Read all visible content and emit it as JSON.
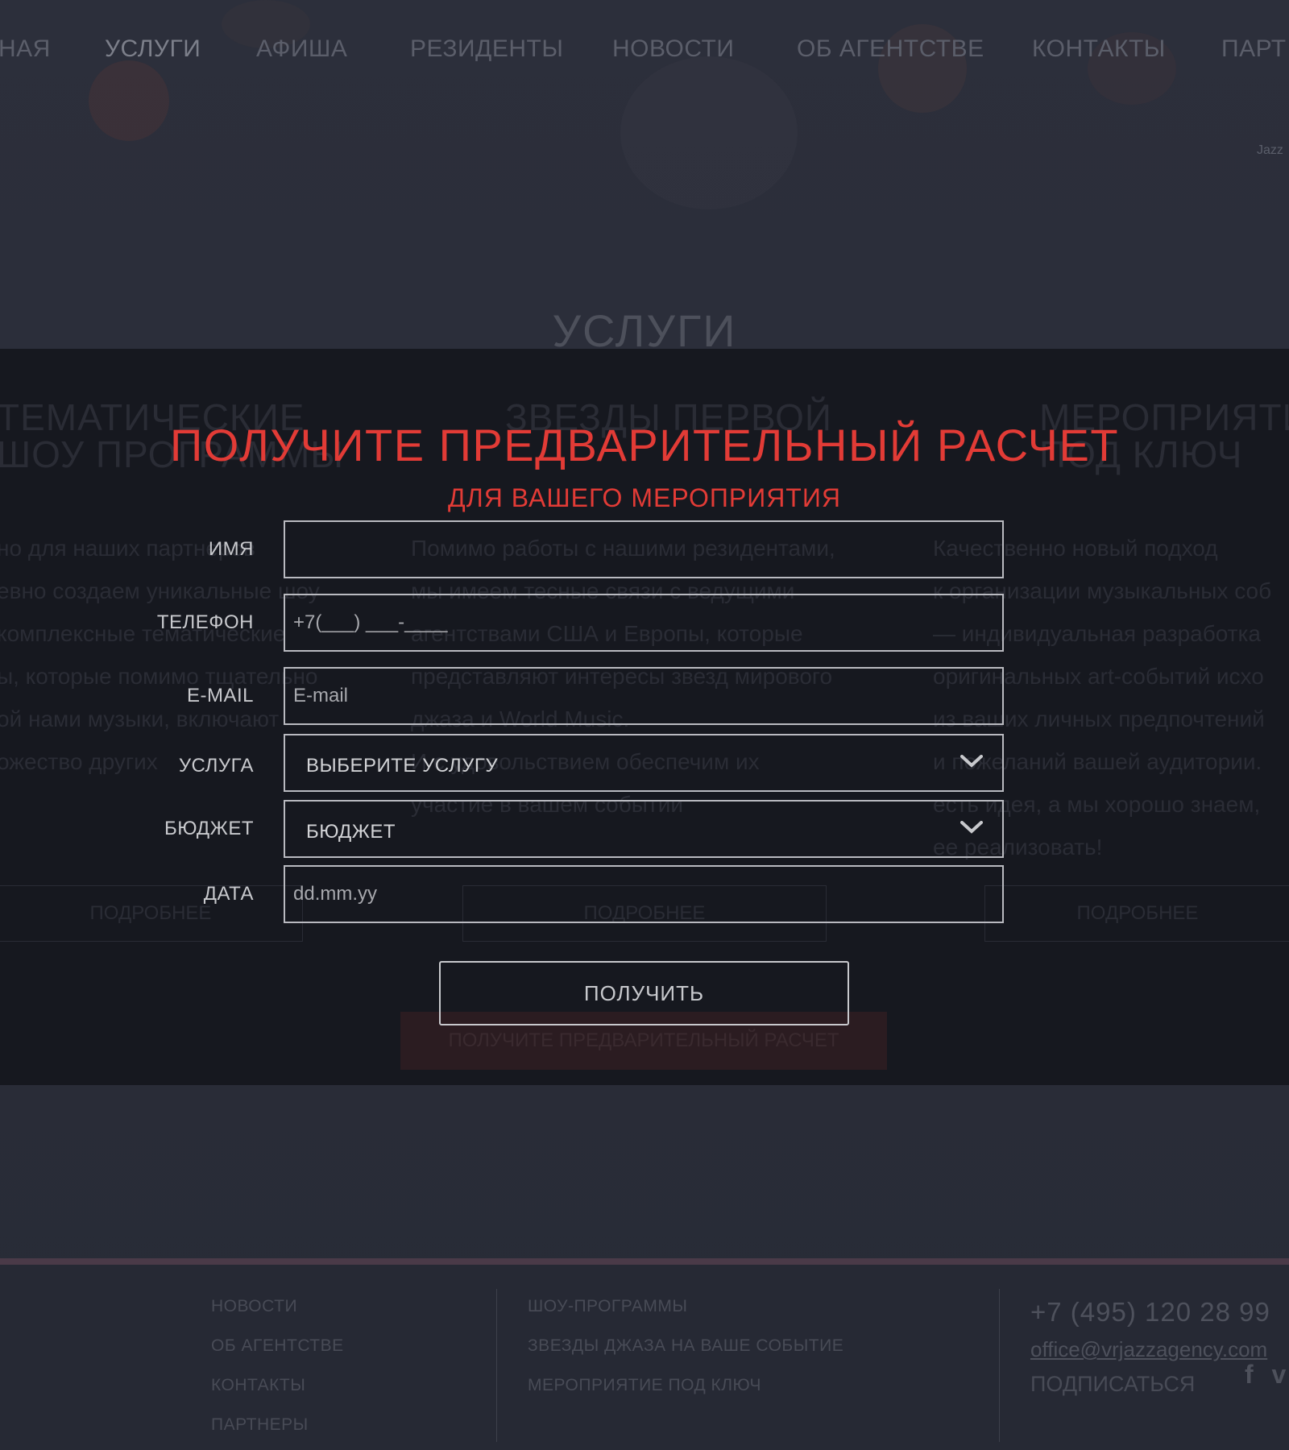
{
  "background": {
    "nav": [
      {
        "label": "НАЯ"
      },
      {
        "label": "УСЛУГИ"
      },
      {
        "label": "АФИША"
      },
      {
        "label": "РЕЗИДЕНТЫ"
      },
      {
        "label": "НОВОСТИ"
      },
      {
        "label": "ОБ АГЕНТСТВЕ"
      },
      {
        "label": "КОНТАКТЫ"
      },
      {
        "label": "ПАРТ"
      }
    ],
    "jazz_text": "Jazz",
    "section_title": "УСЛУГИ",
    "ghost_headings": [
      "ТЕМАТИЧЕСКИЕ",
      "ШОУ ПРОГРАММЫ",
      "ЗВЕЗДЫ ПЕРВОЙ",
      "МЕРОПРИЯТИ",
      "ПОД КЛЮЧ"
    ],
    "ghost_col1": [
      "но для наших партнеров",
      "евно создаем уникальные шоу",
      "комплексные тематические",
      "ы, которые помимо тщательно",
      "ой нами музыки, включают",
      "ожество других"
    ],
    "ghost_col2": [
      "Помимо работы с нашими резидентами,",
      "мы имеем тесные связи с ведущими",
      "агентствами США и Европы, которые",
      "представляют интересы звезд мирового",
      "джаза и World Music.",
      "И с удовольствием обеспечим их",
      "участие в вашем событии"
    ],
    "ghost_col3": [
      "Качественно новый подход",
      "к организации музыкальных соб",
      "— индивидуальная разработка",
      "оригинальных art-событий исхо",
      "из ваших личных предпочтений",
      "и пожеланий вашей аудитории.",
      "есть идея, а мы хорошо знаем,",
      "ее реализовать!"
    ],
    "ghost_more": "ПОДРОБНЕЕ",
    "ghost_cta": "ПОЛУЧИТЕ ПРЕДВАРИТЕЛЬНЫЙ РАСЧЕТ"
  },
  "modal": {
    "title": "ПОЛУЧИТЕ ПРЕДВАРИТЕЛЬНЫЙ РАСЧЕТ",
    "subtitle": "ДЛЯ ВАШЕГО МЕРОПРИЯТИЯ",
    "fields": {
      "name": {
        "label": "ИМЯ",
        "value": "",
        "placeholder": ""
      },
      "phone": {
        "label": "ТЕЛЕФОН",
        "value": "",
        "placeholder": "+7(___) ___-____"
      },
      "email": {
        "label": "E-MAIL",
        "value": "",
        "placeholder": "E-mail"
      },
      "service": {
        "label": "УСЛУГА",
        "selected": "ВЫБЕРИТЕ УСЛУГУ"
      },
      "budget": {
        "label": "БЮДЖЕТ",
        "selected": "БЮДЖЕТ"
      },
      "date": {
        "label": "ДАТА",
        "value": "",
        "placeholder": "dd.mm.yy"
      }
    },
    "submit_label": "ПОЛУЧИТЬ"
  },
  "footer": {
    "col1": [
      "НОВОСТИ",
      "ОБ АГЕНТСТВЕ",
      "КОНТАКТЫ",
      "ПАРТНЕРЫ"
    ],
    "col2": [
      "ШОУ-ПРОГРАММЫ",
      "ЗВЕЗДЫ ДЖАЗА НА ВАШЕ СОБЫТИЕ",
      "МЕРОПРИЯТИЕ ПОД КЛЮЧ"
    ],
    "phone": "+7 (495) 120 28 99",
    "email": "office@vrjazzagency.com",
    "subscribe": "ПОДПИСАТЬСЯ",
    "social_icons": [
      "facebook-icon",
      "vk-icon"
    ]
  },
  "colors": {
    "accent": "#e23b36",
    "overlay": "#16181e",
    "field_border": "#b9bac0"
  }
}
